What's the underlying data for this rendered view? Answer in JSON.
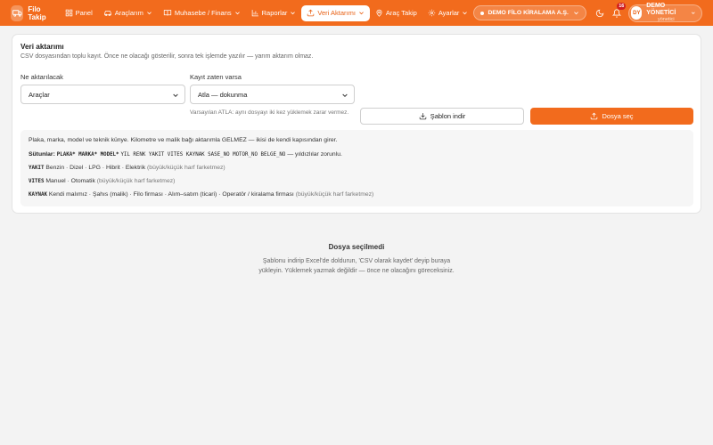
{
  "brand": {
    "name": "Filo Takip",
    "logo_icon": "truck-icon"
  },
  "nav": {
    "items": [
      {
        "label": "Panel",
        "icon": "home-icon"
      },
      {
        "label": "Araçlarım",
        "icon": "car-icon",
        "dropdown": true
      },
      {
        "label": "Muhasebe / Finans",
        "icon": "book-icon",
        "dropdown": true
      },
      {
        "label": "Raporlar",
        "icon": "chart-icon",
        "dropdown": true
      },
      {
        "label": "Veri Aktarımı",
        "icon": "upload-icon",
        "dropdown": true,
        "active": true
      },
      {
        "label": "Araç Takip",
        "icon": "map-pin-icon"
      },
      {
        "label": "Ayarlar",
        "icon": "gear-icon",
        "dropdown": true
      }
    ]
  },
  "company": {
    "name": "DEMO FİLO KİRALAMA A.Ş."
  },
  "notifications": {
    "count": "16"
  },
  "user": {
    "initials": "DY",
    "name": "DEMO YÖNETİCİ",
    "role": "yönetici"
  },
  "card": {
    "title": "Veri aktarımı",
    "subtitle": "CSV dosyasından toplu kayıt. Önce ne olacağı gösterilir, sonra tek işlemde yazılır — yarım aktarım olmaz.",
    "what_label": "Ne aktarılacak",
    "what_value": "Araçlar",
    "exists_label": "Kayıt zaten varsa",
    "exists_value": "Atla — dokunma",
    "exists_hint": "Varsayılan ATLA: aynı dosyayı iki kez yüklemek zarar vermez.",
    "template_button": "Şablon indir",
    "choose_button": "Dosya seç"
  },
  "info": {
    "intro": "Plaka, marka, model ve teknik künye. Kilometre ve malik bağı aktarımla GELMEZ — ikisi de kendi kapısından girer.",
    "columns_label": "Sütunlar:",
    "columns_required": "PLAKA* MARKA* MODEL*",
    "columns_rest": "YIL RENK YAKIT VITES KAYNAK SASE_NO MOTOR_NO BELGE_NO",
    "columns_note": "— yıldızlılar zorunlu.",
    "fuel_key": "YAKIT",
    "fuel_values": "Benzin · Dizel · LPG · Hibrit · Elektrik",
    "fuel_note": "(büyük/küçük harf farketmez)",
    "gear_key": "VITES",
    "gear_values": "Manuel · Otomatik",
    "gear_note": "(büyük/küçük harf farketmez)",
    "source_key": "KAYNAK",
    "source_values": "Kendi malımız · Şahıs (malik) · Filo firması · Alım–satım (ticari) · Operatör / kiralama firması",
    "source_note": "(büyük/küçük harf farketmez)"
  },
  "empty": {
    "title": "Dosya seçilmedi",
    "body": "Şablonu indirip Excel'de doldurun, 'CSV olarak kaydet' deyip buraya yükleyin. Yüklemek yazmak değildir — önce ne olacağını göreceksiniz."
  },
  "colors": {
    "accent": "#f26b1d",
    "badge": "#d11f1f",
    "page_bg": "#f3f3f3"
  }
}
